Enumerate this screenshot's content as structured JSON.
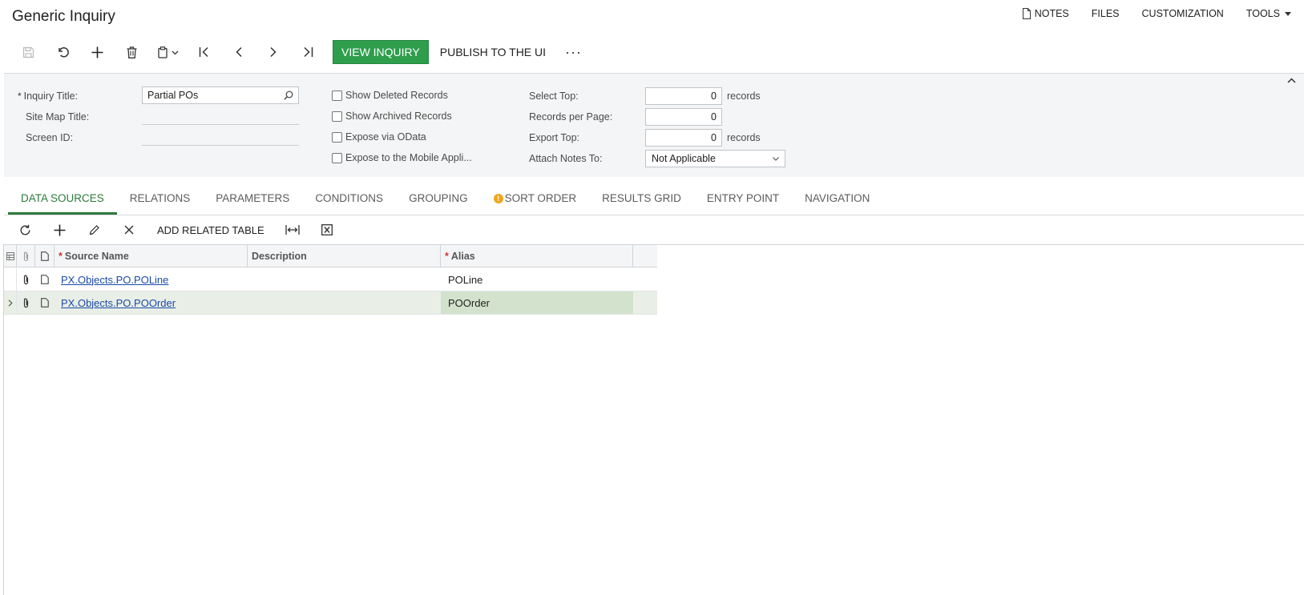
{
  "header": {
    "title": "Generic Inquiry",
    "links": {
      "notes": "NOTES",
      "files": "FILES",
      "customization": "CUSTOMIZATION",
      "tools": "TOOLS"
    }
  },
  "toolbar": {
    "view_inquiry": "VIEW INQUIRY",
    "publish": "PUBLISH TO THE UI",
    "more": "···"
  },
  "form": {
    "inquiry_title_label": "Inquiry Title:",
    "inquiry_title_value": "Partial POs",
    "site_map_title_label": "Site Map Title:",
    "screen_id_label": "Screen ID:",
    "show_deleted": "Show Deleted Records",
    "show_archived": "Show Archived Records",
    "expose_odata": "Expose via OData",
    "expose_mobile": "Expose to the Mobile Appli...",
    "select_top_label": "Select Top:",
    "select_top_value": "0",
    "records_per_page_label": "Records per Page:",
    "records_per_page_value": "0",
    "export_top_label": "Export Top:",
    "export_top_value": "0",
    "records_unit": "records",
    "attach_notes_label": "Attach Notes To:",
    "attach_notes_value": "Not Applicable",
    "required_mark": "*"
  },
  "tabs": [
    {
      "label": "DATA SOURCES"
    },
    {
      "label": "RELATIONS"
    },
    {
      "label": "PARAMETERS"
    },
    {
      "label": "CONDITIONS"
    },
    {
      "label": "GROUPING"
    },
    {
      "label": "SORT ORDER",
      "warning": "!"
    },
    {
      "label": "RESULTS GRID"
    },
    {
      "label": "ENTRY POINT"
    },
    {
      "label": "NAVIGATION"
    }
  ],
  "grid_toolbar": {
    "add_related_table": "ADD RELATED TABLE"
  },
  "grid": {
    "columns": {
      "source_name": "Source Name",
      "description": "Description",
      "alias": "Alias",
      "required_mark": "*"
    },
    "rows": [
      {
        "source_name": "PX.Objects.PO.POLine",
        "description": "",
        "alias": "POLine"
      },
      {
        "source_name": "PX.Objects.PO.POOrder",
        "description": "",
        "alias": "POOrder"
      }
    ]
  }
}
